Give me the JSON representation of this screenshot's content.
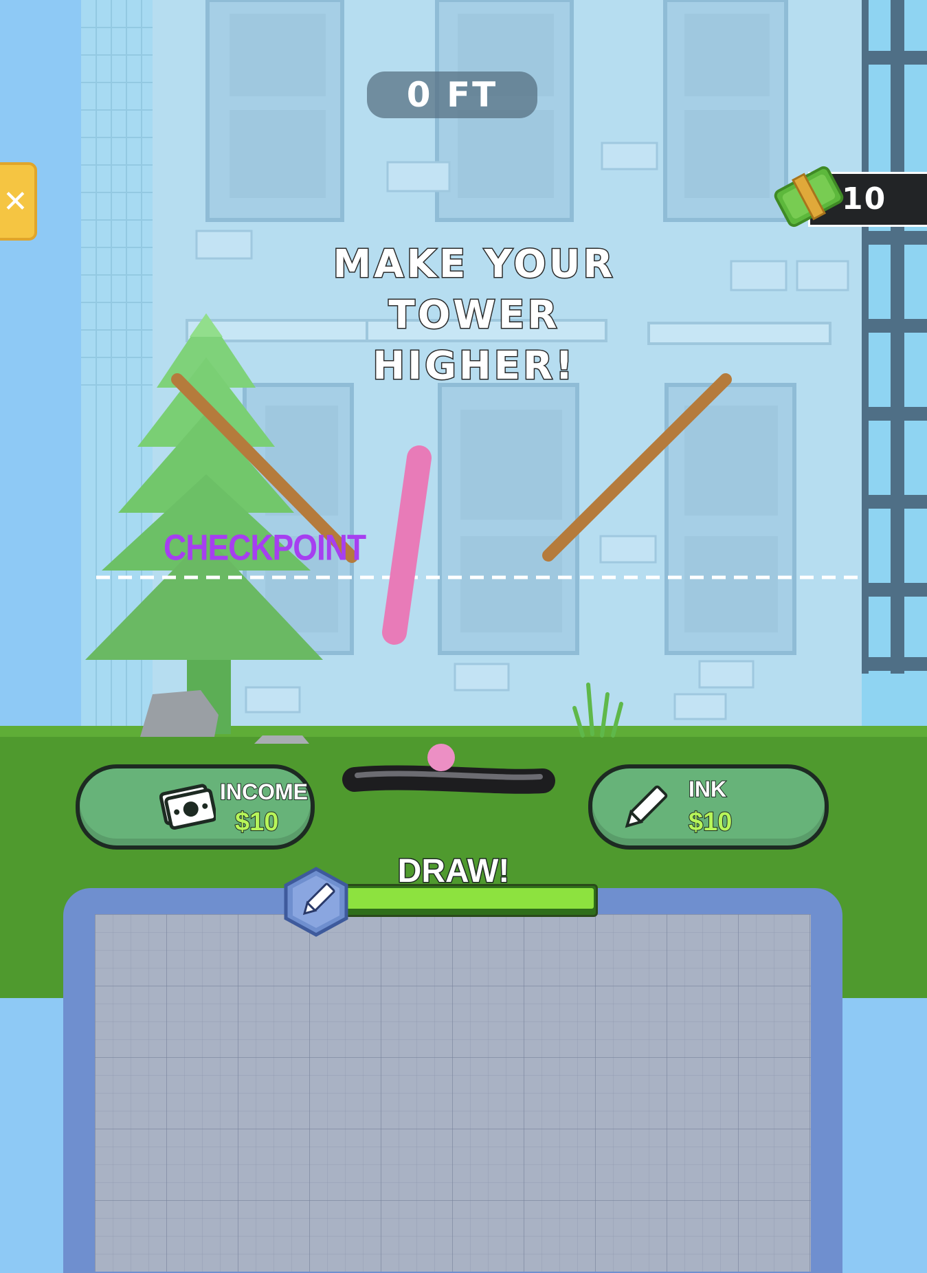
{
  "hud": {
    "height_readout": "0 FT",
    "cash_count": "10",
    "close_glyph": "✕"
  },
  "prompt": {
    "line1": "MAKE YOUR",
    "line2": "TOWER",
    "line3": "HIGHER!"
  },
  "scene": {
    "checkpoint_label": "CHECKPOINT"
  },
  "upgrades": {
    "income": {
      "label": "INCOME",
      "price": "$10",
      "icon": "cash-icon"
    },
    "ink": {
      "label": "INK",
      "price": "$10",
      "icon": "pencil-icon"
    }
  },
  "draw": {
    "label": "DRAW!",
    "ink_level": 1.0,
    "icon": "pencil-icon"
  },
  "colors": {
    "sky": "#8ec9f5",
    "building": "#b6ddf0",
    "grass": "#4f9a2e",
    "checkpoint": "#a63ff0",
    "ink_bar": "#8de23f",
    "upgrade_button": "#67b379",
    "drawing_stick": "#e87bb8",
    "plank": "#b57b3c"
  }
}
